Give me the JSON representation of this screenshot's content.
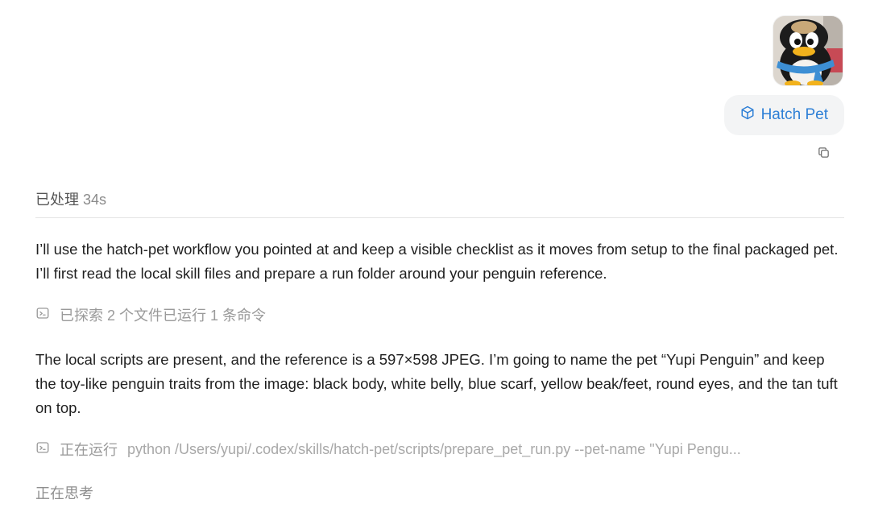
{
  "user_message": {
    "attachment": {
      "alt": "penguin toy photo"
    },
    "skill_chip": {
      "label": "Hatch Pet",
      "icon": "cube-icon",
      "color": "#2d7fd6"
    },
    "copy_icon": "copy-icon"
  },
  "status": {
    "label": "已处理",
    "duration": "34s"
  },
  "assistant": {
    "paragraph1": "I’ll use the hatch-pet workflow you pointed at and keep a visible checklist as it moves from setup to the final packaged pet. I’ll first read the local skill files and prepare a run folder around your penguin reference.",
    "activity1": {
      "icon": "terminal-icon",
      "label": "已探索 2 个文件已运行 1 条命令"
    },
    "paragraph2": "The local scripts are present, and the reference is a 597×598 JPEG. I’m going to name the pet “Yupi Penguin” and keep the toy-like penguin traits from the image: black body, white belly, blue scarf, yellow beak/feet, round eyes, and the tan tuft on top.",
    "activity2": {
      "icon": "terminal-icon",
      "label": "正在运行",
      "command": "python /Users/yupi/.codex/skills/hatch-pet/scripts/prepare_pet_run.py --pet-name \"Yupi Pengu..."
    },
    "thinking": "正在思考"
  }
}
